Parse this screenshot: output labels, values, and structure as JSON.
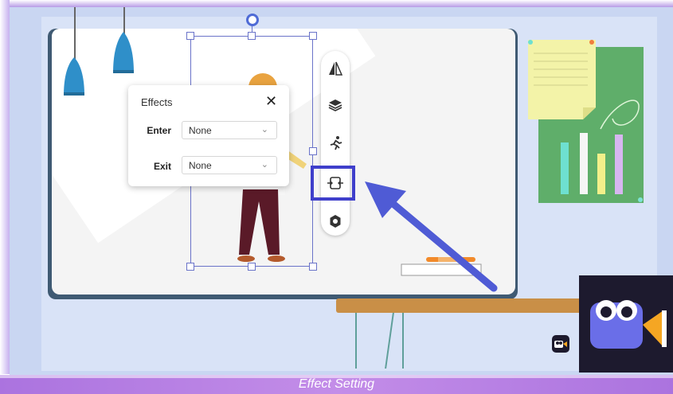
{
  "effects_panel": {
    "title": "Effects",
    "close_icon": "✕",
    "enter_label": "Enter",
    "enter_value": "None",
    "exit_label": "Exit",
    "exit_value": "None",
    "chevron_icon": "⌄"
  },
  "toolbar": {
    "tools": [
      "flip-icon",
      "layers-icon",
      "animation-icon",
      "transition-icon",
      "settings-icon"
    ]
  },
  "colors": {
    "highlight": "#3f3fcb",
    "arrow": "#4f5bd5",
    "caption_bar": "#ab73df"
  },
  "caption": "Effect Setting"
}
